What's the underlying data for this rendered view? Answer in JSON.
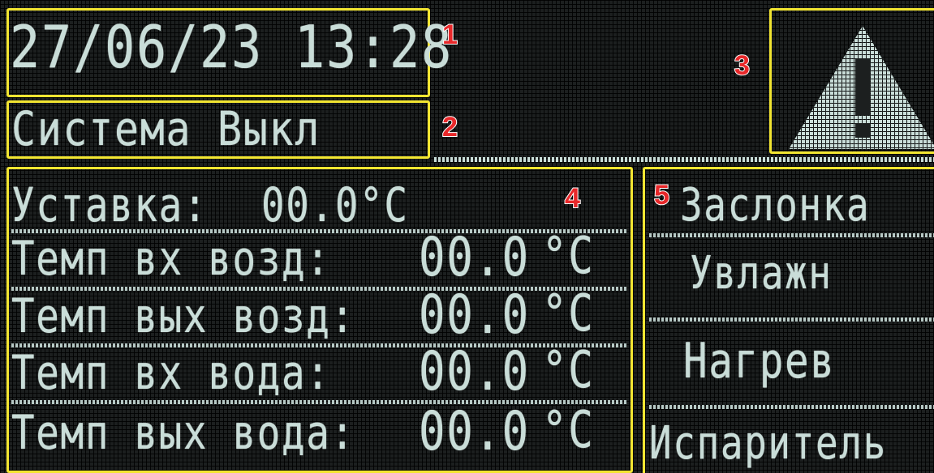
{
  "header": {
    "datetime": "27/06/23 13:28",
    "system_status": "Система Выкл"
  },
  "alarm": {
    "icon": "warning-triangle-icon"
  },
  "readings": {
    "setpoint": {
      "label": "Уставка:",
      "value": "00.0°C"
    },
    "rows": [
      {
        "label": "Темп вх возд:",
        "value": "00.0",
        "unit": "°C"
      },
      {
        "label": "Темп вых возд:",
        "value": "00.0",
        "unit": "°C"
      },
      {
        "label": "Темп вх вода:",
        "value": "00.0",
        "unit": "°C"
      },
      {
        "label": "Темп вых вода:",
        "value": "00.0",
        "unit": "°C"
      }
    ]
  },
  "menu": {
    "items": [
      {
        "label": "Заслонка"
      },
      {
        "label": "Увлажн"
      },
      {
        "label": "Нагрев"
      },
      {
        "label": "Испаритель"
      }
    ]
  },
  "markers": [
    "1",
    "2",
    "3",
    "4",
    "5"
  ],
  "colors": {
    "lcd_text": "#c9ddd8",
    "highlight": "#f2e531",
    "marker": "#e8282a",
    "background": "#1c1f1f"
  }
}
